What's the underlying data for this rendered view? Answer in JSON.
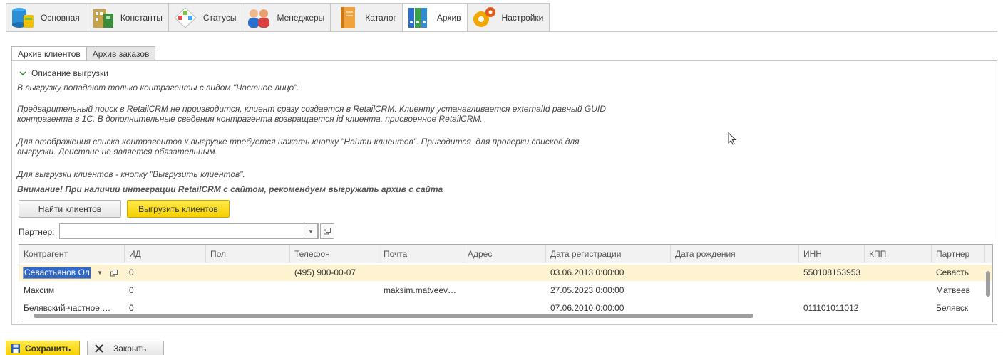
{
  "top_tabs": [
    {
      "label": "Основная",
      "icon": "database-icon"
    },
    {
      "label": "Константы",
      "icon": "building-icon"
    },
    {
      "label": "Статусы",
      "icon": "workflow-icon"
    },
    {
      "label": "Менеджеры",
      "icon": "users-icon"
    },
    {
      "label": "Каталог",
      "icon": "book-icon"
    },
    {
      "label": "Архив",
      "icon": "binders-icon"
    },
    {
      "label": "Настройки",
      "icon": "gears-icon"
    }
  ],
  "sub_tabs": [
    "Архив клиентов",
    "Архив заказов"
  ],
  "description": {
    "title": "Описание выгрузки",
    "line1": "В выгрузку попадают только контрагенты с видом \"Частное лицо\".",
    "line2a": "Предварительный поиск в RetailCRM не производится, клиент сразу создается в RetailCRM. Клиенту устанавливается externalId равный GUID",
    "line2b": "контрагента в 1С. В дополнительные сведения контрагента возвращается id клиента, присвоенное RetailCRM.",
    "line3a": "Для отображения списка контрагентов к выгрузке требуется нажать кнопку \"Найти клиентов\". Пригодится  для проверки списков для",
    "line3b": "выгрузки. Действие не является обязательным.",
    "line4": "Для выгрузки клиентов - кнопку \"Выгрузить клиентов\".",
    "warning": "Внимание! При наличии интеграции RetailCRM с сайтом, рекомендуем выгружать архив с сайта"
  },
  "buttons": {
    "find": "Найти клиентов",
    "export": "Выгрузить клиентов",
    "save": "Сохранить",
    "close": "Закрыть"
  },
  "partner": {
    "label": "Партнер:",
    "value": ""
  },
  "table": {
    "columns": [
      "Контрагент",
      "ИД",
      "Пол",
      "Телефон",
      "Почта",
      "Адрес",
      "Дата регистрации",
      "Дата рождения",
      "ИНН",
      "КПП",
      "Партнер"
    ],
    "rows": [
      [
        "Севастьянов Ол",
        "0",
        "",
        "(495) 900-00-07",
        "",
        "",
        "03.06.2013 0:00:00",
        "",
        "550108153953",
        "",
        "Севасть"
      ],
      [
        "Максим",
        "0",
        "",
        "",
        "maksim.matveev…",
        "",
        "27.05.2023 0:00:00",
        "",
        "",
        "",
        "Матвеев"
      ],
      [
        "Белявский-частное …",
        "0",
        "",
        "",
        "",
        "",
        "07.06.2010 0:00:00",
        "",
        "011101011012",
        "",
        "Белявск"
      ]
    ]
  },
  "colors": {
    "accent": "#f5d000",
    "selected_row": "#fdf3d0",
    "selection": "#3068c8"
  }
}
